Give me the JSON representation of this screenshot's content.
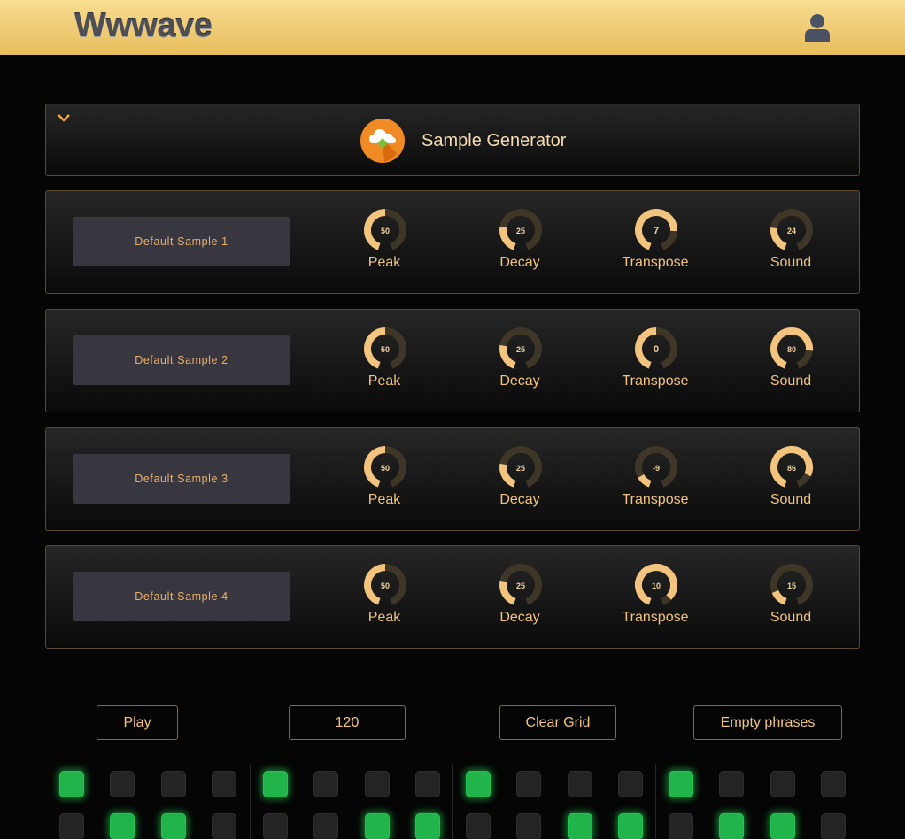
{
  "app": {
    "logo": "Wwwave"
  },
  "header": {
    "user_icon": "user-icon"
  },
  "generator": {
    "title": "Sample Generator",
    "icon": "cloud-diamond-icon",
    "toggle_icon": "chevron-down-icon"
  },
  "samples": [
    {
      "name": "Default Sample 1",
      "knobs": [
        {
          "label": "Peak",
          "value": "50",
          "level": 0.5
        },
        {
          "label": "Decay",
          "value": "25",
          "level": 0.25
        },
        {
          "label": "Transpose",
          "value": "7",
          "level": 0.79
        },
        {
          "label": "Sound",
          "value": "24",
          "level": 0.24
        }
      ]
    },
    {
      "name": "Default Sample 2",
      "knobs": [
        {
          "label": "Peak",
          "value": "50",
          "level": 0.5
        },
        {
          "label": "Decay",
          "value": "25",
          "level": 0.25
        },
        {
          "label": "Transpose",
          "value": "0",
          "level": 0.5
        },
        {
          "label": "Sound",
          "value": "80",
          "level": 0.8
        }
      ]
    },
    {
      "name": "Default Sample 3",
      "knobs": [
        {
          "label": "Peak",
          "value": "50",
          "level": 0.5
        },
        {
          "label": "Decay",
          "value": "25",
          "level": 0.25
        },
        {
          "label": "Transpose",
          "value": "-9",
          "level": 0.125
        },
        {
          "label": "Sound",
          "value": "86",
          "level": 0.86
        }
      ]
    },
    {
      "name": "Default Sample 4",
      "knobs": [
        {
          "label": "Peak",
          "value": "50",
          "level": 0.5
        },
        {
          "label": "Decay",
          "value": "25",
          "level": 0.25
        },
        {
          "label": "Transpose",
          "value": "10",
          "level": 0.92
        },
        {
          "label": "Sound",
          "value": "15",
          "level": 0.15
        }
      ]
    }
  ],
  "controls": {
    "play": "Play",
    "tempo": "120",
    "clear": "Clear Grid",
    "empty": "Empty phrases"
  },
  "sequencer": {
    "rows": [
      [
        1,
        0,
        0,
        0,
        1,
        0,
        0,
        0,
        1,
        0,
        0,
        0,
        1,
        0,
        0,
        0
      ],
      [
        0,
        1,
        1,
        0,
        0,
        0,
        1,
        1,
        0,
        0,
        1,
        1,
        0,
        1,
        1,
        0
      ]
    ]
  },
  "colors": {
    "accent": "#f2c47f",
    "knob_fill": "#f3c47d",
    "knob_track": "#3e3627",
    "step_on": "#20b44a",
    "step_off": "#242424"
  }
}
